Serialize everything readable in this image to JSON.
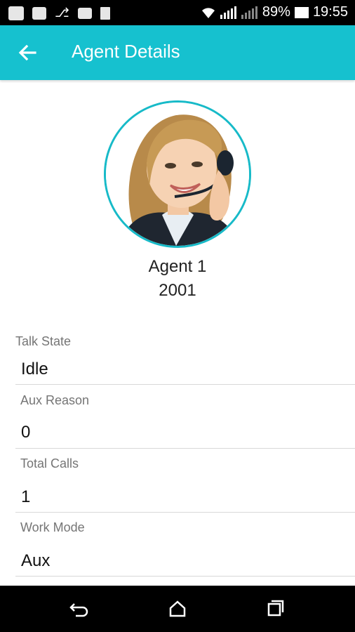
{
  "status_bar": {
    "battery": "89%",
    "time": "19:55"
  },
  "header": {
    "title": "Agent Details"
  },
  "agent": {
    "name": "Agent 1",
    "extension": "2001"
  },
  "fields": [
    {
      "label": "Talk State",
      "value": "Idle"
    },
    {
      "label": "Aux Reason",
      "value": "0"
    },
    {
      "label": "Total Calls",
      "value": "1"
    },
    {
      "label": "Work Mode",
      "value": "Aux"
    }
  ],
  "colors": {
    "appbar": "#16c1cf",
    "avatar_ring": "#17bac8"
  }
}
